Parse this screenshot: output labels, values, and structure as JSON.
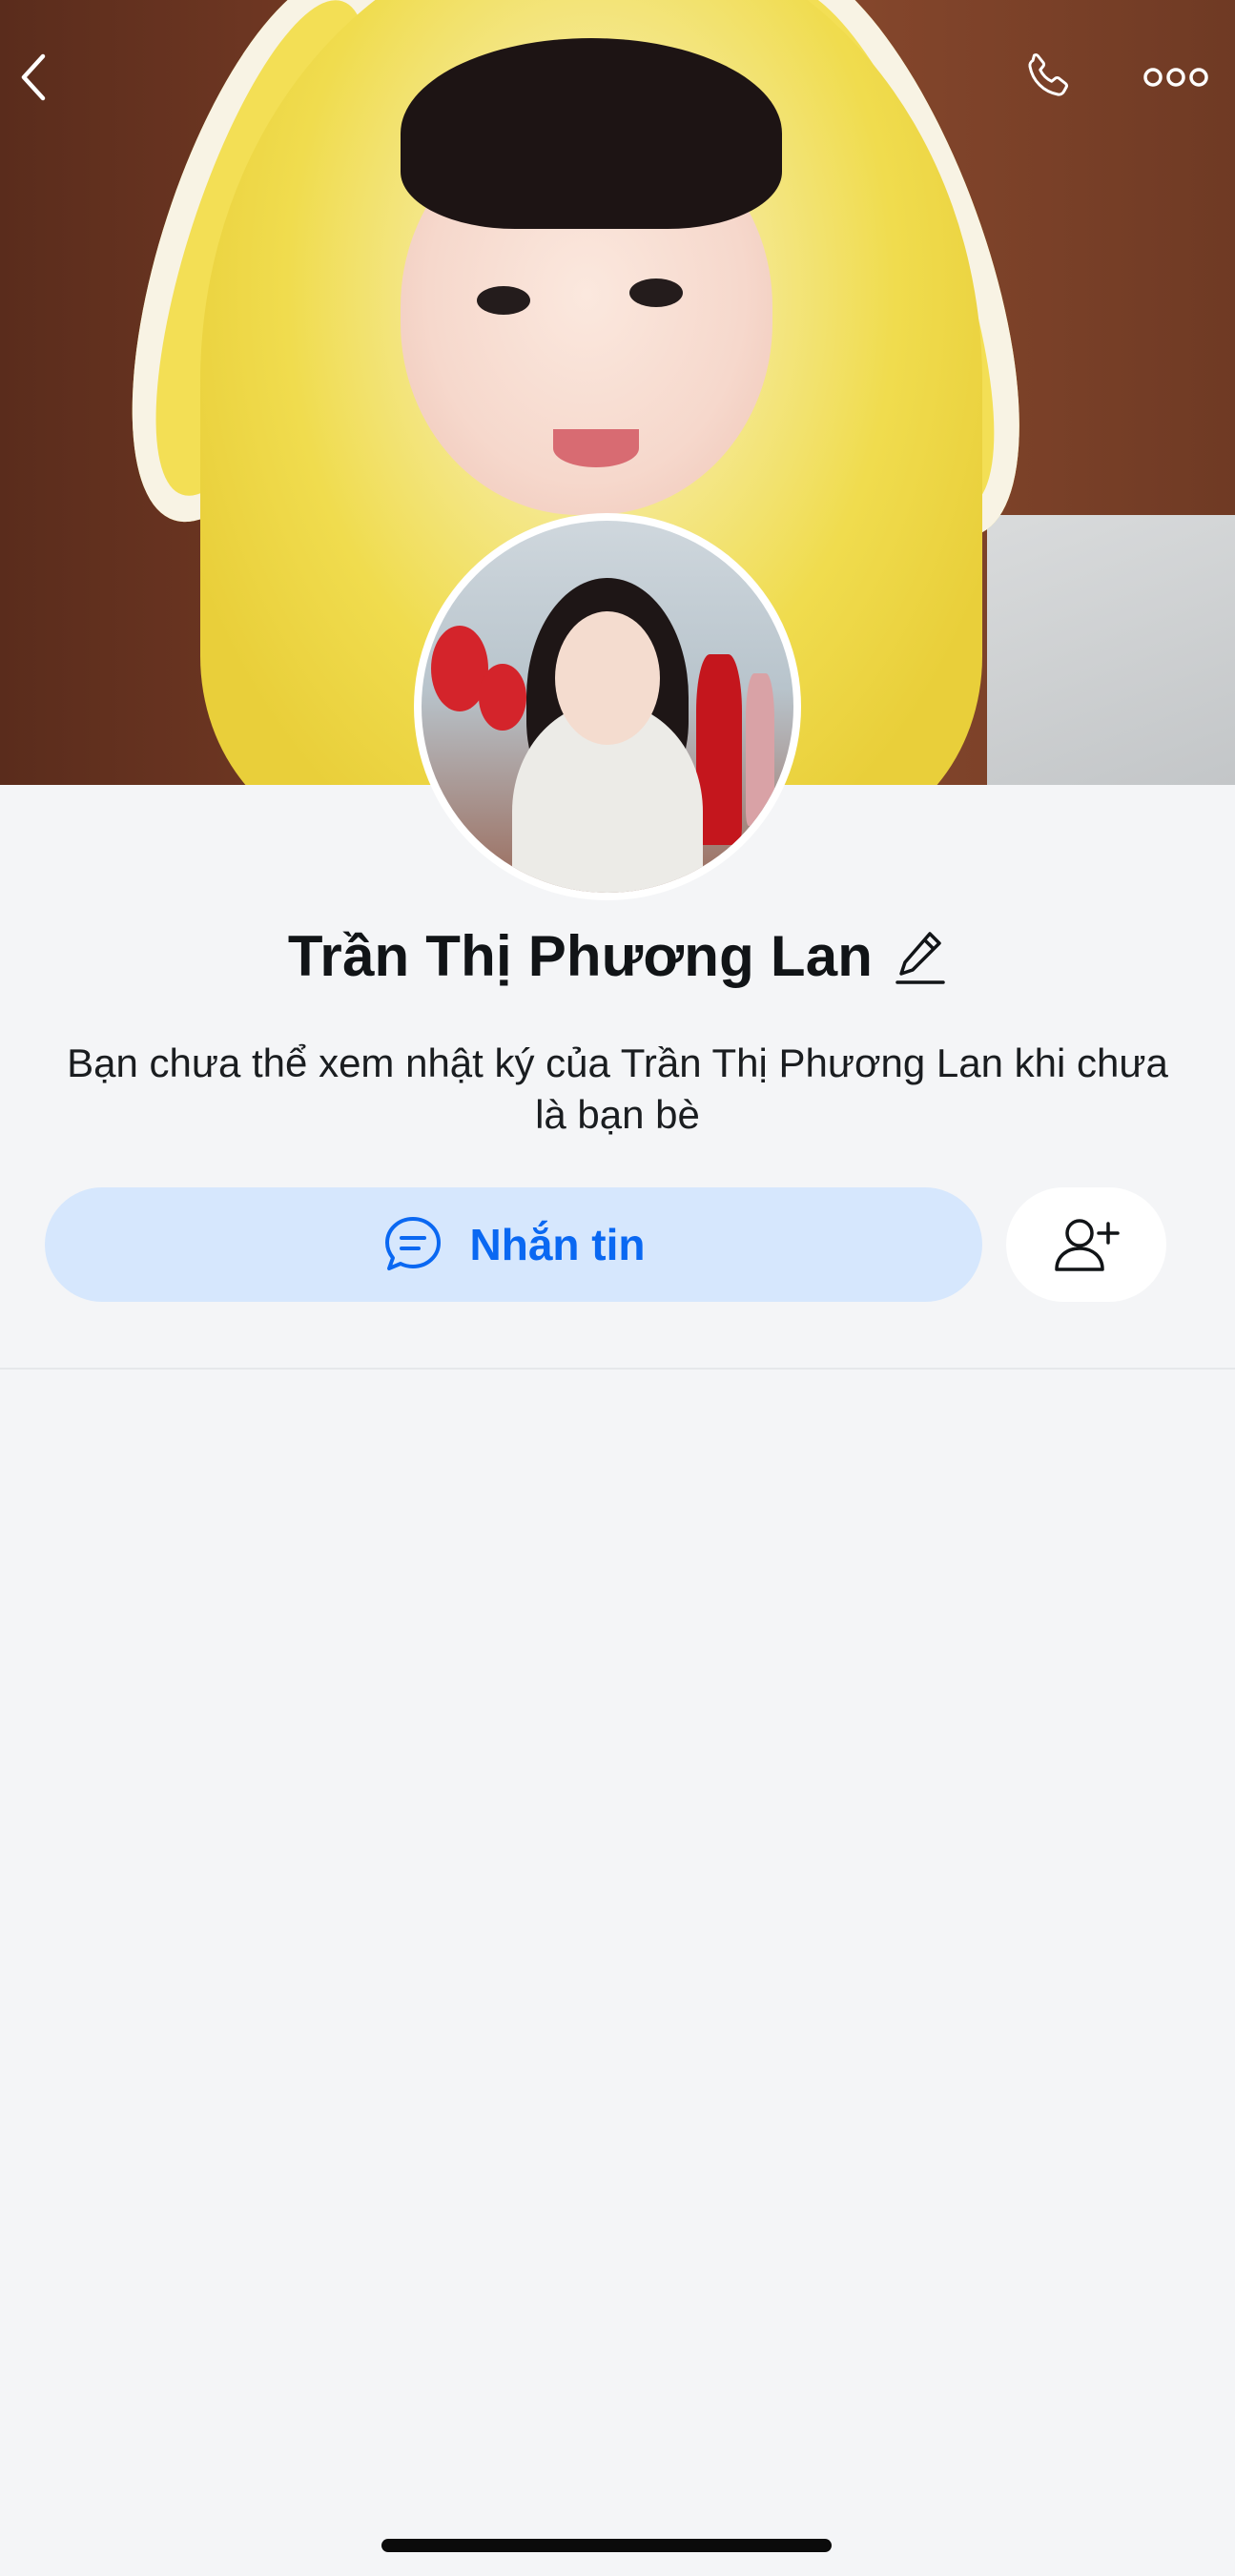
{
  "profile": {
    "name": "Trần Thị Phương Lan",
    "notice": "Bạn chưa thể xem nhật ký của Trần Thị Phương Lan khi chưa là bạn bè"
  },
  "actions": {
    "message_label": "Nhắn tin"
  },
  "icons": {
    "back": "chevron-left-icon",
    "call": "phone-icon",
    "more": "more-dots-icon",
    "edit": "pencil-icon",
    "message": "chat-bubble-icon",
    "add_friend": "add-friend-icon"
  },
  "colors": {
    "accent": "#0a68f2",
    "message_button_bg": "#d6e7fd",
    "page_bg": "#f4f5f7"
  }
}
